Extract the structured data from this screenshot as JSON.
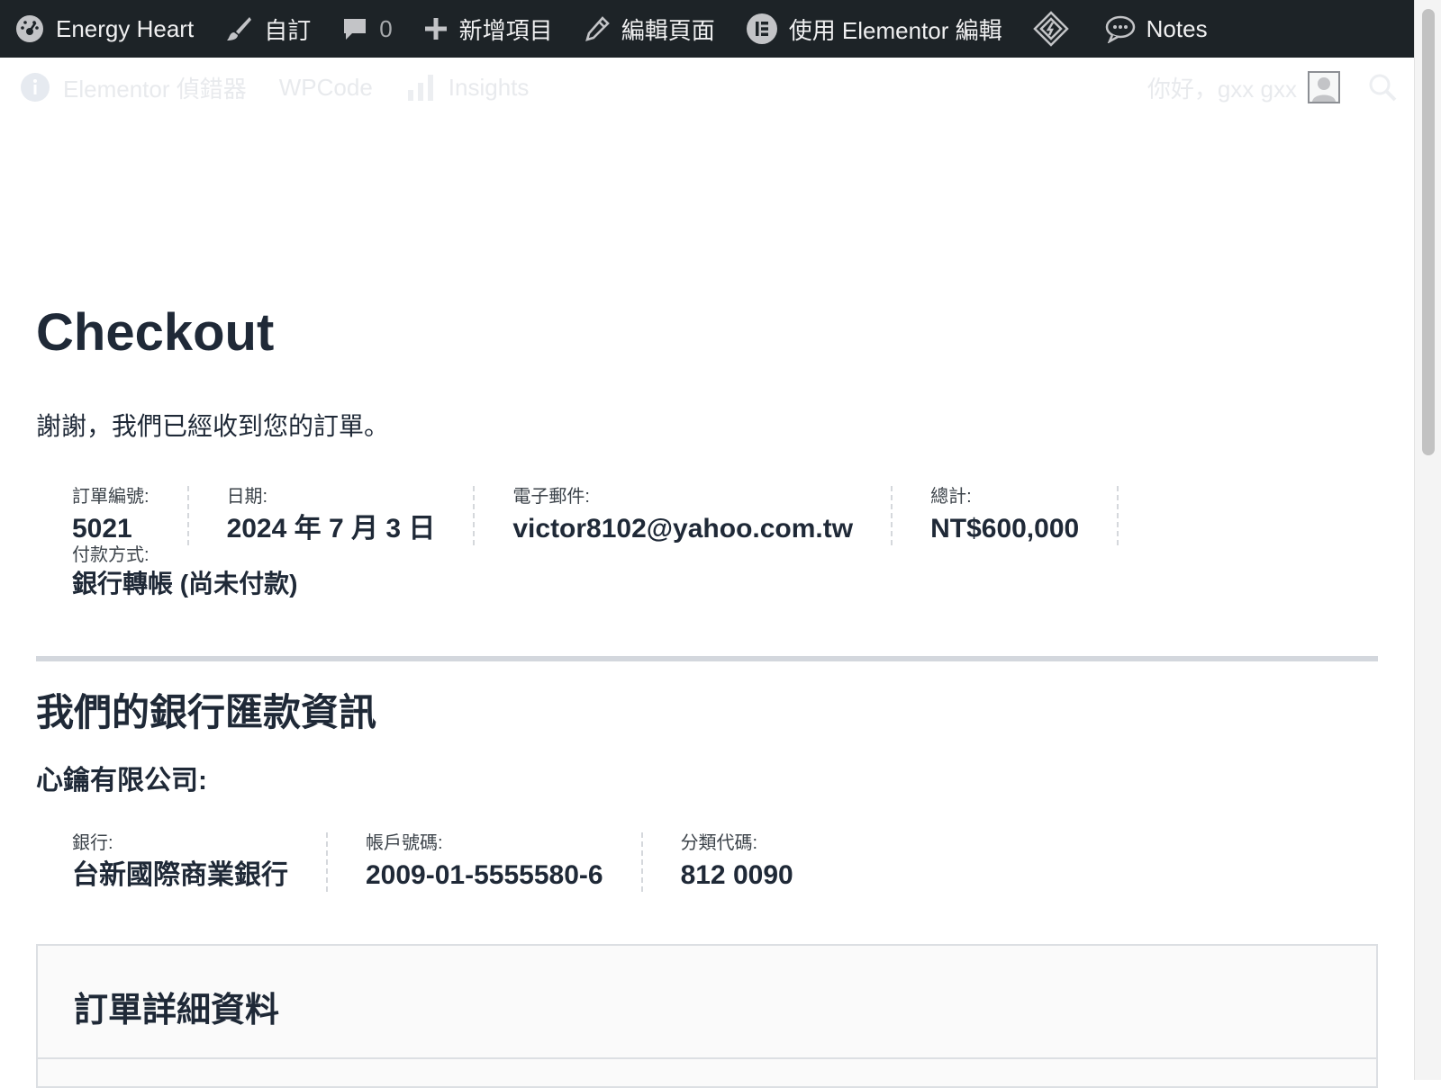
{
  "adminbar": {
    "site_name": "Energy Heart",
    "customize_label": "自訂",
    "comments_count": "0",
    "new_label": "新增項目",
    "edit_label": "編輯頁面",
    "elementor_label": "使用 Elementor 編輯",
    "notes_label": "Notes"
  },
  "subbar": {
    "debugger_label": "Elementor 偵錯器",
    "wpcode_label": "WPCode",
    "insights_label": "Insights",
    "greeting": "你好，gxx gxx"
  },
  "page": {
    "title": "Checkout",
    "thanks": "謝謝，我們已經收到您的訂單。"
  },
  "order_overview": {
    "order_label": "訂單編號:",
    "order_value": "5021",
    "date_label": "日期:",
    "date_value": "2024 年 7 月 3 日",
    "email_label": "電子郵件:",
    "email_value": "victor8102@yahoo.com.tw",
    "total_label": "總計:",
    "total_value": "NT$600,000",
    "method_label": "付款方式:",
    "method_value": "銀行轉帳 (尚未付款)"
  },
  "bank": {
    "heading": "我們的銀行匯款資訊",
    "company": "心鑰有限公司:",
    "bank_label": "銀行:",
    "bank_value": "台新國際商業銀行",
    "account_label": "帳戶號碼:",
    "account_value": "2009-01-5555580-6",
    "sort_label": "分類代碼:",
    "sort_value": "812 0090"
  },
  "order_details": {
    "heading": "訂單詳細資料"
  },
  "icons": {
    "dashboard": "dashboard-icon",
    "customize": "brush-icon",
    "comments": "comment-icon",
    "new": "plus-icon",
    "edit": "pencil-icon",
    "elementor": "elementor-icon",
    "diamond": "diamond-icon",
    "notes": "chat-bubble-icon",
    "info": "info-icon",
    "insights": "bar-chart-icon",
    "search": "search-icon"
  }
}
